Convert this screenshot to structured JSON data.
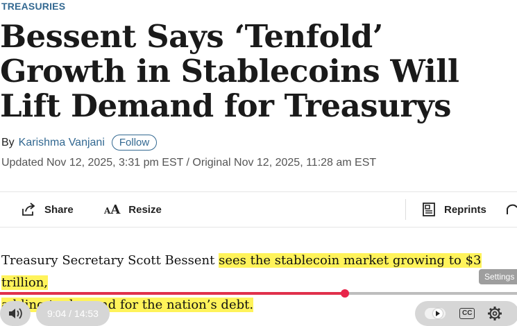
{
  "article": {
    "section": "TREASURIES",
    "headline": "Bessent Says ‘Tenfold’ Growth in Stablecoins Will Lift Demand for Treasurys",
    "byline_prefix": "By",
    "author": "Karishma Vanjani",
    "follow_label": "Follow",
    "updated": "Updated Nov 12, 2025, 3:31 pm EST / Original Nov 12, 2025, 11:28 am EST",
    "body_plain": "Treasury Secretary Scott Bessent ",
    "body_highlight_1": "sees the stablecoin market growing to $3 trillion,",
    "body_highlight_2": "adding to demand for the nation’s debt."
  },
  "toolbar": {
    "share_label": "Share",
    "resize_label": "Resize",
    "reprints_label": "Reprints"
  },
  "player": {
    "time": "9:04 / 14:53",
    "progress_fraction": 0.667,
    "settings_tooltip": "Settings"
  },
  "colors": {
    "accent": "#326891",
    "highlight": "#fff35a",
    "progress": "#e0314b"
  },
  "icons": [
    "share-icon",
    "text-resize-icon",
    "reprints-icon",
    "headphones-icon",
    "volume-icon",
    "play-icon",
    "cc-icon",
    "gear-icon"
  ]
}
